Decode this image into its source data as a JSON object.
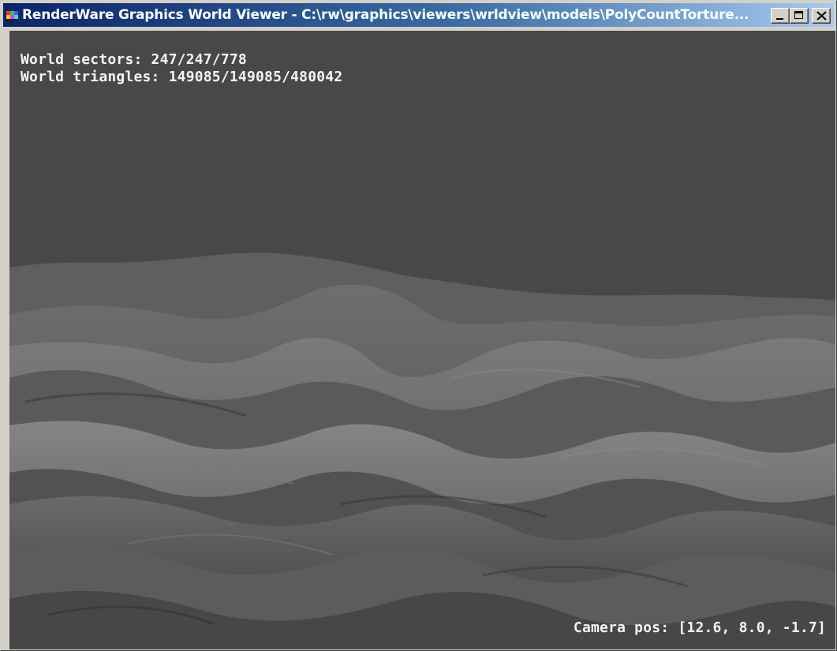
{
  "window": {
    "title": "RenderWare Graphics World Viewer - C:\\rw\\graphics\\viewers\\wrldview\\models\\PolyCountTorture...",
    "icon": "renderware-app-icon",
    "buttons": {
      "minimize": "minimize-icon",
      "maximize": "maximize-icon",
      "close": "close-icon"
    }
  },
  "hud": {
    "world_sectors": "World sectors: 247/247/778",
    "world_triangles": "World triangles: 149085/149085/480042",
    "camera_pos": "Camera pos: [12.6, 8.0, -1.7]"
  },
  "colors": {
    "titlebar_start": "#0a246a",
    "titlebar_end": "#a6caf0",
    "viewport_background": "#484848",
    "hud_text": "#f4f4f4"
  }
}
